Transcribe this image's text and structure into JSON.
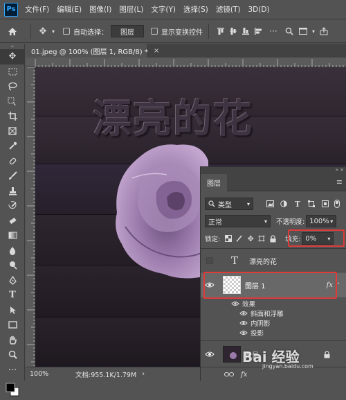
{
  "app": {
    "logo": "Ps"
  },
  "menu": [
    "文件(F)",
    "编辑(E)",
    "图像(I)",
    "图层(L)",
    "文字(Y)",
    "选择(S)",
    "滤镜(T)",
    "3D(D)"
  ],
  "options": {
    "auto_select_label": "自动选择：",
    "auto_select_value": "图层",
    "show_transform_label": "显示变换控件",
    "more": "···"
  },
  "document": {
    "tab_title": "01.jpeg @ 100% (图层 1, RGB/8) *",
    "close": "×",
    "canvas_text": "漂亮的花"
  },
  "status": {
    "zoom": "100%",
    "doc_size": "文档:955.1K/1.79M",
    "arrow": "›"
  },
  "layers_panel": {
    "title": "图层",
    "kind_filter": "类型",
    "blend_mode": "正常",
    "opacity_label": "不透明度:",
    "opacity_value": "100%",
    "lock_label": "锁定:",
    "fill_label": "填充:",
    "fill_value": "0%",
    "layers": [
      {
        "name": "漂亮的花",
        "type_glyph": "T"
      },
      {
        "name": "图层 1",
        "fx": "fx"
      },
      {
        "name": "效果"
      },
      {
        "name": "斜面和浮雕"
      },
      {
        "name": "内阴影"
      },
      {
        "name": "投影"
      },
      {
        "name": "背景"
      }
    ],
    "footer_fx": "fx"
  },
  "watermark": "Bai 经验",
  "watermark_url": "jingyan.baidu.com",
  "colors": {
    "accent_red": "#e03a3a",
    "rose": "#9a7aab",
    "wood": "#2c242d"
  }
}
